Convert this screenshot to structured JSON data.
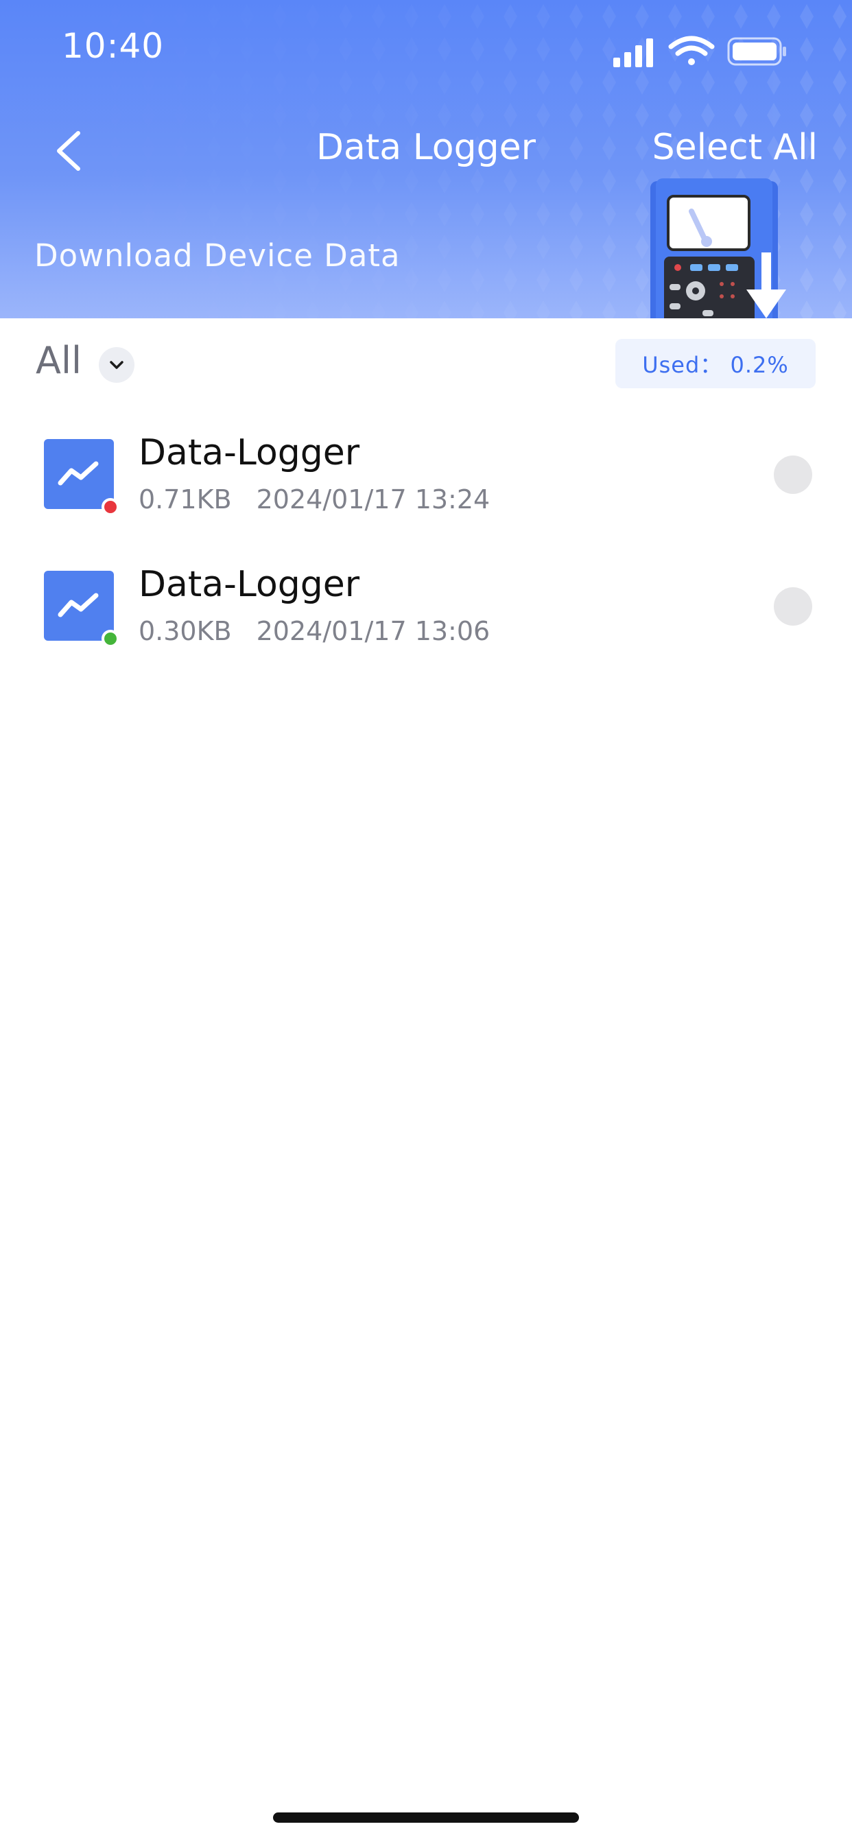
{
  "status_bar": {
    "time": "10:40"
  },
  "header": {
    "title": "Data Logger",
    "select_all_label": "Select All",
    "subtitle": "Download Device Data",
    "back_icon": "chevron-left-icon"
  },
  "filter": {
    "selected": "All",
    "usage_label": "Used：  0.2%"
  },
  "files": [
    {
      "name": "Data-Logger",
      "size": "0.71KB",
      "datetime": "2024/01/17 13:24",
      "status_color": "#e8363d",
      "selected": false
    },
    {
      "name": "Data-Logger",
      "size": "0.30KB",
      "datetime": "2024/01/17 13:06",
      "status_color": "#44b53a",
      "selected": false
    }
  ],
  "colors": {
    "header_gradient_top": "#5a86f8",
    "header_gradient_bottom": "#9bb5fb",
    "accent": "#3d6ff0",
    "file_icon_bg": "#5080ef"
  }
}
